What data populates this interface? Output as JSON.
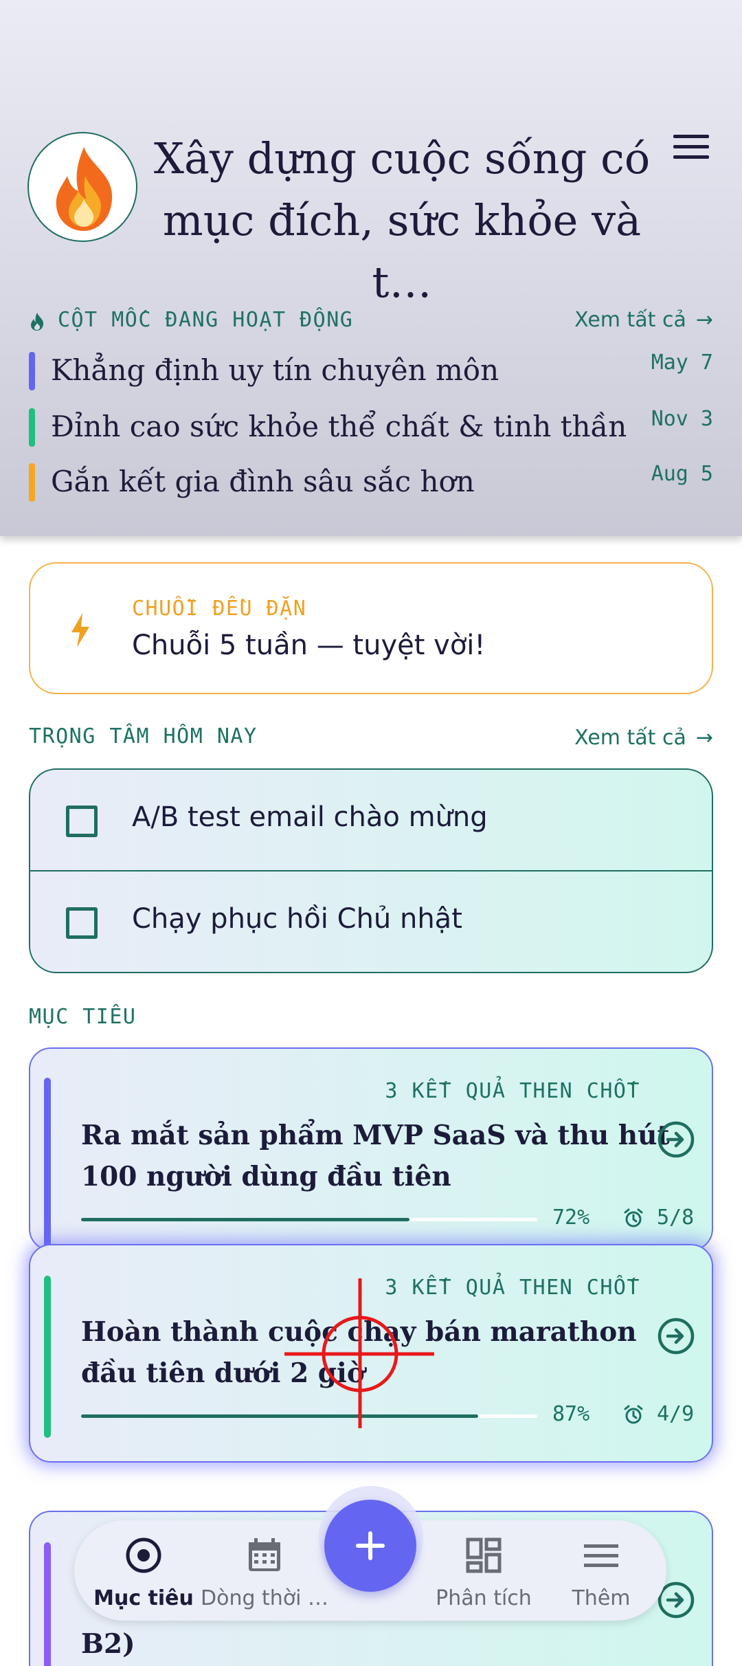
{
  "header": {
    "title": "Xây dựng cuộc sống có mục đích, sức khỏe và t…",
    "avatar_icon": "flame-icon"
  },
  "milestones": {
    "heading": "CỘT MỐC ĐANG HOẠT ĐỘNG",
    "see_all": "Xem tất cả",
    "items": [
      {
        "text": "Khẳng định uy tín chuyên môn",
        "date": "May 7",
        "color": "#6466f1"
      },
      {
        "text": "Đỉnh cao sức khỏe thể chất & tinh thần",
        "date": "Nov 3",
        "color": "#1fbf7f"
      },
      {
        "text": "Gắn kết gia đình sâu sắc hơn",
        "date": "Aug 5",
        "color": "#f5a623"
      }
    ]
  },
  "streak": {
    "label": "CHUỖI ĐỀU ĐẶN",
    "text": "Chuỗi 5 tuần — tuyệt vời!",
    "color": "#f0a020"
  },
  "focus": {
    "heading": "TRỌNG TÂM HÔM NAY",
    "see_all": "Xem tất cả",
    "tasks": [
      {
        "text": "A/B test email chào mừng",
        "checked": false
      },
      {
        "text": "Chạy phục hồi Chủ nhật",
        "checked": false
      }
    ]
  },
  "goals": {
    "heading": "MỤC TIÊU",
    "items": [
      {
        "kr_label": "3 KẾT QUẢ THEN CHỐT",
        "title": "Ra mắt sản phẩm MVP SaaS và thu hút 100 người dùng đầu tiên",
        "progress": 0.72,
        "progress_text": "72%",
        "kr_count": "5/8",
        "color": "#6466f1"
      },
      {
        "kr_label": "3 KẾT QUẢ THEN CHỐT",
        "title": "Hoàn thành cuộc chạy bán marathon đầu tiên dưới 2 giờ",
        "progress": 0.87,
        "progress_text": "87%",
        "kr_count": "4/9",
        "color": "#1fbf7f"
      },
      {
        "kr_label": "",
        "title": "B2)",
        "color": "#8b5cf6"
      }
    ]
  },
  "nav": {
    "items": [
      {
        "label": "Mục tiêu",
        "icon": "target-icon",
        "active": true
      },
      {
        "label": "Dòng thời …",
        "icon": "calendar-icon",
        "active": false
      },
      {
        "label": "Phân tích",
        "icon": "dashboard-icon",
        "active": false
      },
      {
        "label": "Thêm",
        "icon": "menu-icon",
        "active": false
      }
    ],
    "fab_icon": "plus-icon"
  },
  "colors": {
    "accent": "#6466f1",
    "teal": "#1d7163",
    "ink": "#1c1b3a"
  }
}
